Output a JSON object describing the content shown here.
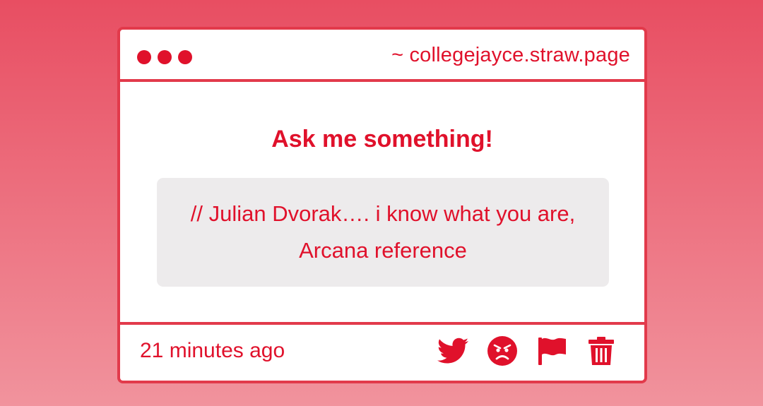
{
  "window": {
    "url": "~ collegejayce.straw.page"
  },
  "main": {
    "prompt": "Ask me something!",
    "question": "// Julian Dvorak…. i know what you are, Arcana reference"
  },
  "footer": {
    "timestamp": "21 minutes ago",
    "actions": [
      {
        "icon": "twitter-icon"
      },
      {
        "icon": "angry-face-icon"
      },
      {
        "icon": "flag-icon"
      },
      {
        "icon": "trash-icon"
      }
    ]
  },
  "colors": {
    "accent": "#e0112b",
    "border": "#e23a4b",
    "question_bg": "#edebec",
    "background_top": "#e84e62",
    "background_bottom": "#f1939d"
  }
}
